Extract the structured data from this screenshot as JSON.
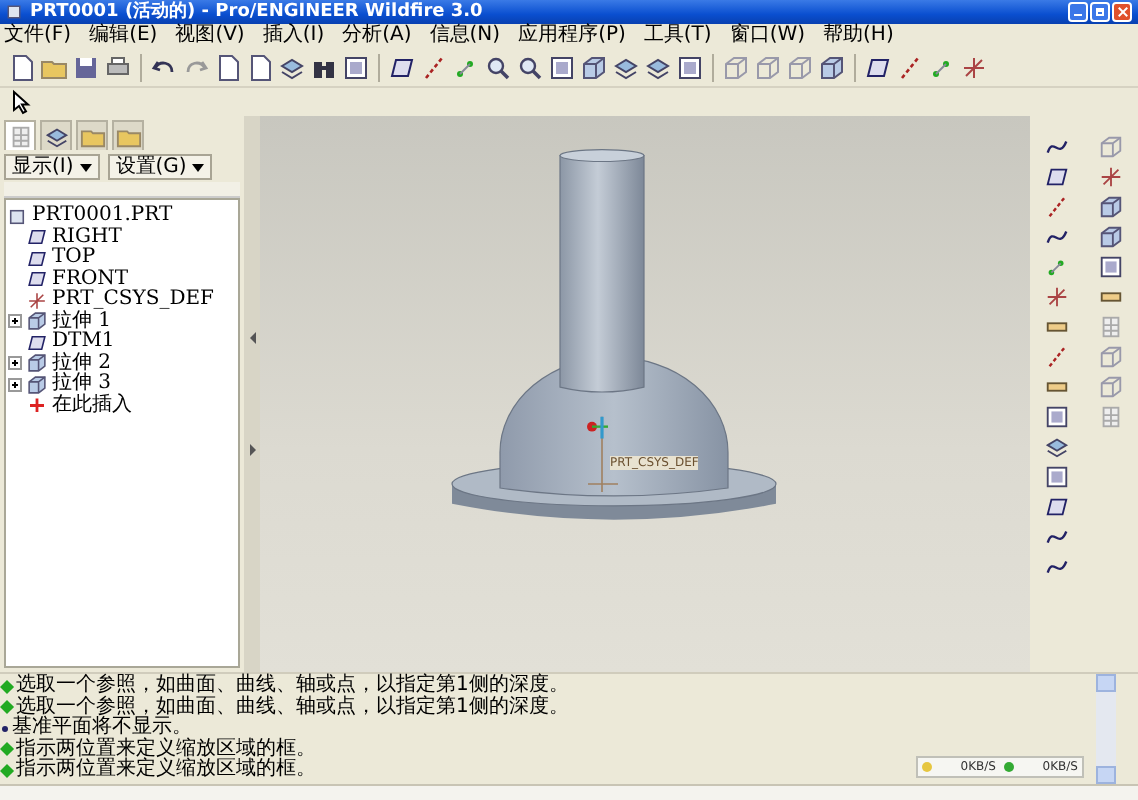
{
  "window": {
    "title": "PRT0001 (活动的) - Pro/ENGINEER Wildfire 3.0"
  },
  "menu": [
    "文件(F)",
    "编辑(E)",
    "视图(V)",
    "插入(I)",
    "分析(A)",
    "信息(N)",
    "应用程序(P)",
    "工具(T)",
    "窗口(W)",
    "帮助(H)"
  ],
  "panel_tabs": [
    {
      "selected": true
    },
    {
      "selected": false
    },
    {
      "selected": false
    },
    {
      "selected": false
    }
  ],
  "panel_buttons": [
    "显示(I)",
    "设置(G)"
  ],
  "model_tree": {
    "label": "PRT0001.PRT",
    "kind": "part",
    "children": [
      {
        "label": "RIGHT",
        "kind": "plane"
      },
      {
        "label": "TOP",
        "kind": "plane"
      },
      {
        "label": "FRONT",
        "kind": "plane"
      },
      {
        "label": "PRT_CSYS_DEF",
        "kind": "csys"
      },
      {
        "label": "拉伸 1",
        "kind": "feature",
        "expanded": false
      },
      {
        "label": "DTM1",
        "kind": "plane"
      },
      {
        "label": "拉伸 2",
        "kind": "feature",
        "expanded": false
      },
      {
        "label": "拉伸 3",
        "kind": "feature",
        "expanded": false
      },
      {
        "label": "在此插入",
        "kind": "insert"
      }
    ]
  },
  "viewport": {
    "csys_label": "PRT_CSYS_DEF"
  },
  "messages": [
    {
      "kind": "prompt",
      "text": "选取一个参照，如曲面、曲线、轴或点，以指定第1侧的深度。"
    },
    {
      "kind": "prompt",
      "text": "选取一个参照，如曲面、曲线、轴或点，以指定第1侧的深度。"
    },
    {
      "kind": "info",
      "text": "基准平面将不显示。"
    },
    {
      "kind": "prompt",
      "text": "指示两位置来定义缩放区域的框。"
    },
    {
      "kind": "prompt",
      "text": "指示两位置来定义缩放区域的框。"
    }
  ],
  "net_speed": {
    "upload": "0KB/S",
    "download": "0KB/S"
  }
}
